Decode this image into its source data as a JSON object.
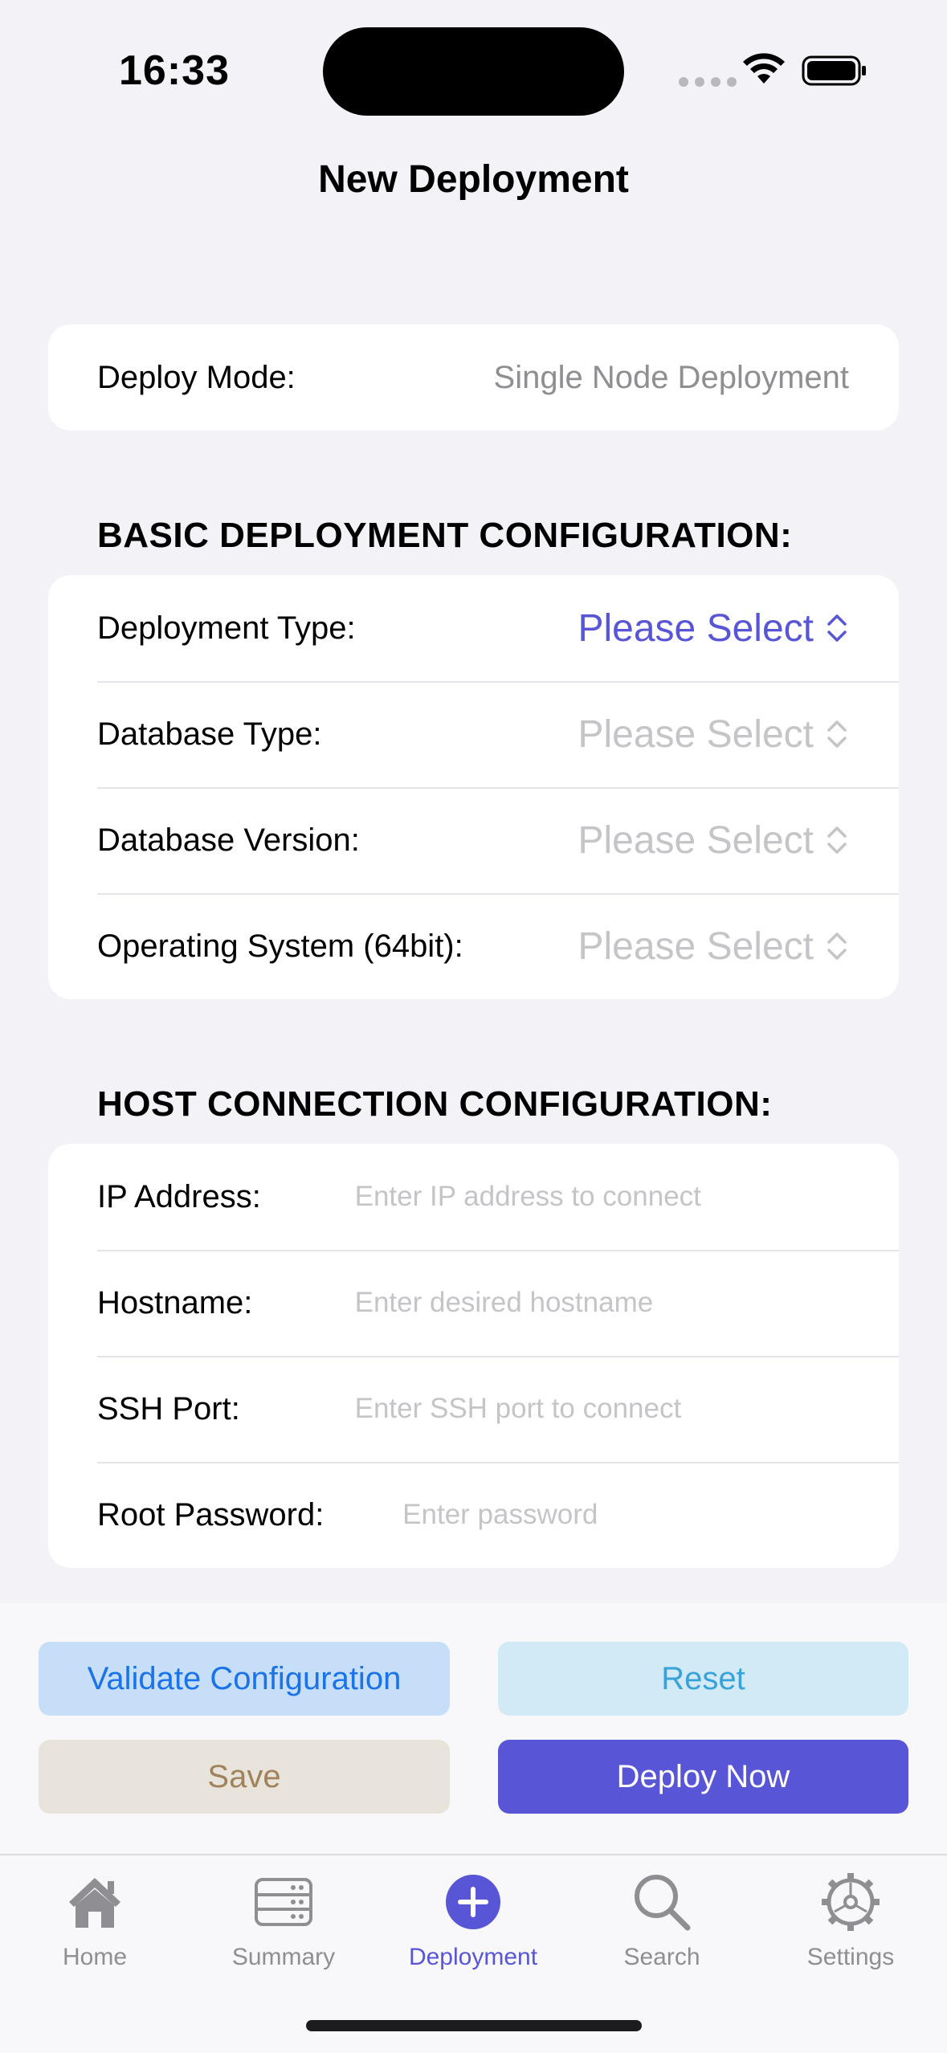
{
  "status_bar": {
    "time": "16:33"
  },
  "nav": {
    "title": "New Deployment"
  },
  "deploy_mode": {
    "label": "Deploy Mode:",
    "value": "Single Node Deployment"
  },
  "basic_config": {
    "header": "BASIC DEPLOYMENT CONFIGURATION:",
    "rows": [
      {
        "label": "Deployment Type:",
        "value": "Please Select"
      },
      {
        "label": "Database Type:",
        "value": "Please Select"
      },
      {
        "label": "Database Version:",
        "value": "Please Select"
      },
      {
        "label": "Operating System (64bit):",
        "value": "Please Select"
      }
    ]
  },
  "host_config": {
    "header": "HOST CONNECTION CONFIGURATION:",
    "rows": [
      {
        "label": "IP Address:",
        "value": "",
        "placeholder": "Enter IP address to connect"
      },
      {
        "label": "Hostname:",
        "value": "",
        "placeholder": "Enter desired hostname"
      },
      {
        "label": "SSH Port:",
        "value": "",
        "placeholder": "Enter SSH port to connect"
      },
      {
        "label": "Root Password:",
        "value": "",
        "placeholder": "Enter password"
      }
    ]
  },
  "actions": {
    "validate": "Validate Configuration",
    "reset": "Reset",
    "save": "Save",
    "deploy": "Deploy Now"
  },
  "tabs": [
    {
      "label": "Home",
      "icon": "house-icon"
    },
    {
      "label": "Summary",
      "icon": "server-rack-icon"
    },
    {
      "label": "Deployment",
      "icon": "plus-circle-icon",
      "selected": true
    },
    {
      "label": "Search",
      "icon": "magnifier-icon"
    },
    {
      "label": "Settings",
      "icon": "gear-icon"
    }
  ],
  "colors": {
    "accent": "#5856d6",
    "background": "#f2f2f7",
    "placeholder": "#c4c4c9",
    "secondary_text": "#8e8e93"
  }
}
